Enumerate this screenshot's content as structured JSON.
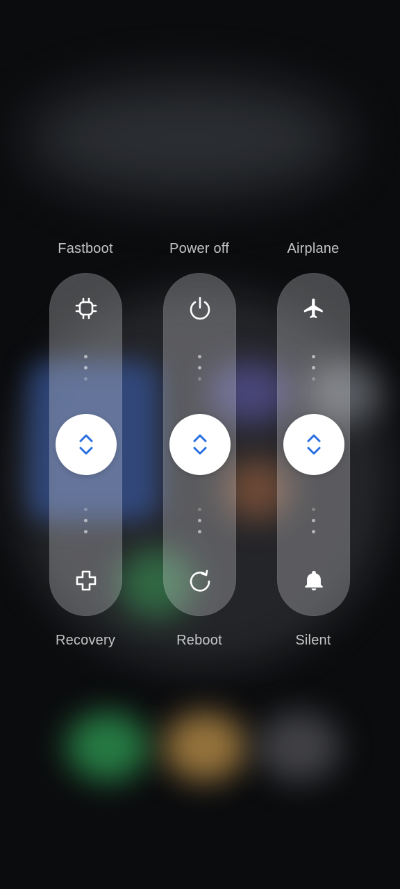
{
  "power_menu": {
    "top_labels": [
      "Fastboot",
      "Power off",
      "Airplane"
    ],
    "bottom_labels": [
      "Recovery",
      "Reboot",
      "Silent"
    ],
    "sliders": [
      {
        "top_icon": "chip-icon",
        "bottom_icon": "plus-icon"
      },
      {
        "top_icon": "power-icon",
        "bottom_icon": "refresh-icon"
      },
      {
        "top_icon": "airplane-icon",
        "bottom_icon": "bell-icon"
      }
    ],
    "accent_color": "#2a6fe0"
  }
}
